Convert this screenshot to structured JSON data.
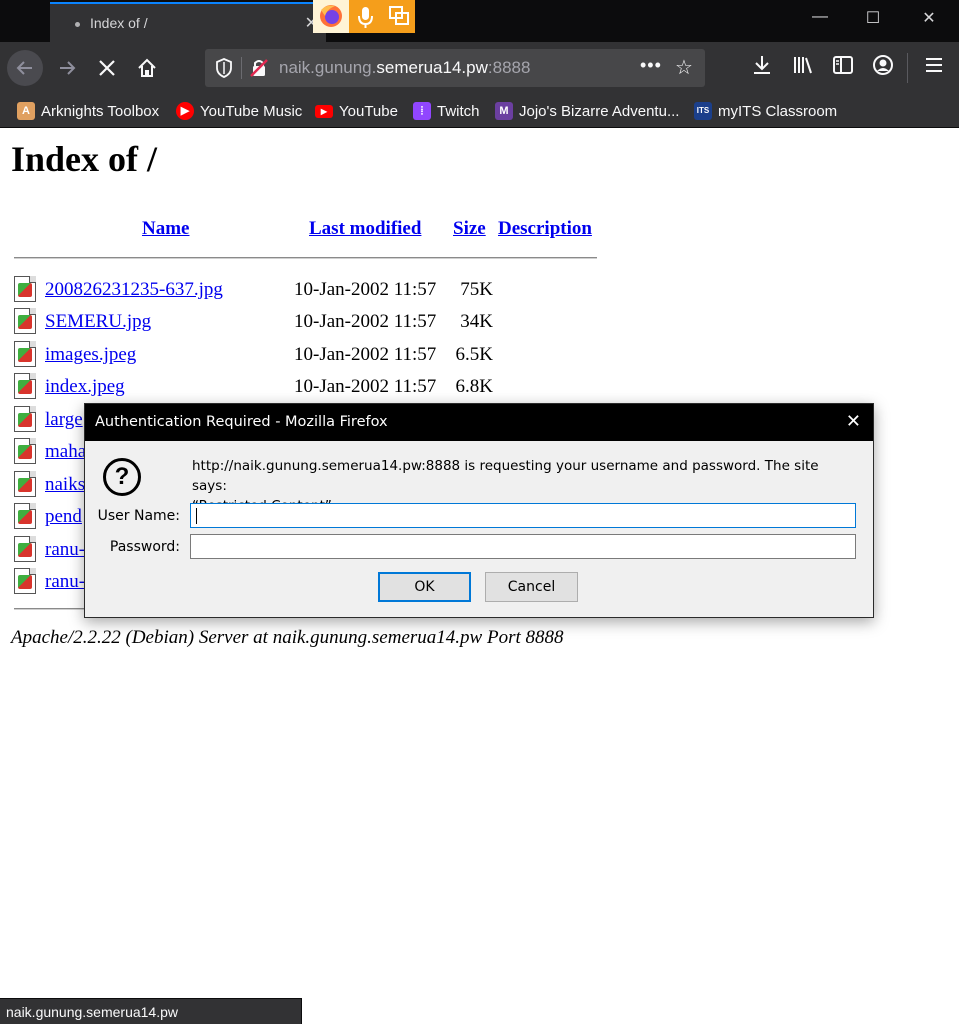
{
  "browser": {
    "tab_title": "Index of /",
    "url_prefix": "naik.gunung.",
    "url_domain": "semerua14.pw",
    "url_port": ":8888",
    "status_url": "naik.gunung.semerua14.pw"
  },
  "bookmarks": [
    {
      "label": "Arknights Toolbox",
      "icon": "arknights-icon",
      "color": "#e0a060"
    },
    {
      "label": "YouTube Music",
      "icon": "youtube-music-icon",
      "color": "#ff0000"
    },
    {
      "label": "YouTube",
      "icon": "youtube-icon",
      "color": "#ff0000"
    },
    {
      "label": "Twitch",
      "icon": "twitch-icon",
      "color": "#9146ff"
    },
    {
      "label": "Jojo's Bizarre Adventu...",
      "icon": "jojo-icon",
      "color": "#6b3fa0"
    },
    {
      "label": "myITS Classroom",
      "icon": "myits-icon",
      "color": "#1b3f8b"
    }
  ],
  "page": {
    "title": "Index of /",
    "headers": {
      "name": "Name",
      "last_modified": "Last modified",
      "size": "Size",
      "description": "Description"
    },
    "files": [
      {
        "name": "200826231235-637.jpg",
        "date": "10-Jan-2002 11:57",
        "size": "75K"
      },
      {
        "name": "SEMERU.jpg",
        "date": "10-Jan-2002 11:57",
        "size": "34K"
      },
      {
        "name": "images.jpeg",
        "date": "10-Jan-2002 11:57",
        "size": "6.5K"
      },
      {
        "name": "index.jpeg",
        "date": "10-Jan-2002 11:57",
        "size": "6.8K"
      },
      {
        "name": "large",
        "date": "",
        "size": ""
      },
      {
        "name": "maha",
        "date": "",
        "size": ""
      },
      {
        "name": "naiks",
        "date": "",
        "size": ""
      },
      {
        "name": "pend",
        "date": "",
        "size": ""
      },
      {
        "name": "ranu-",
        "date": "",
        "size": ""
      },
      {
        "name": "ranu-",
        "date": "",
        "size": ""
      }
    ],
    "address": "Apache/2.2.22 (Debian) Server at naik.gunung.semerua14.pw Port 8888"
  },
  "dialog": {
    "title": "Authentication Required - Mozilla Firefox",
    "message_line1": "http://naik.gunung.semerua14.pw:8888 is requesting your username and password. The site says:",
    "message_line2": "“Restricted Content”",
    "username_label": "User Name:",
    "username_value": "",
    "password_label": "Password:",
    "password_value": "",
    "ok_label": "OK",
    "cancel_label": "Cancel"
  }
}
